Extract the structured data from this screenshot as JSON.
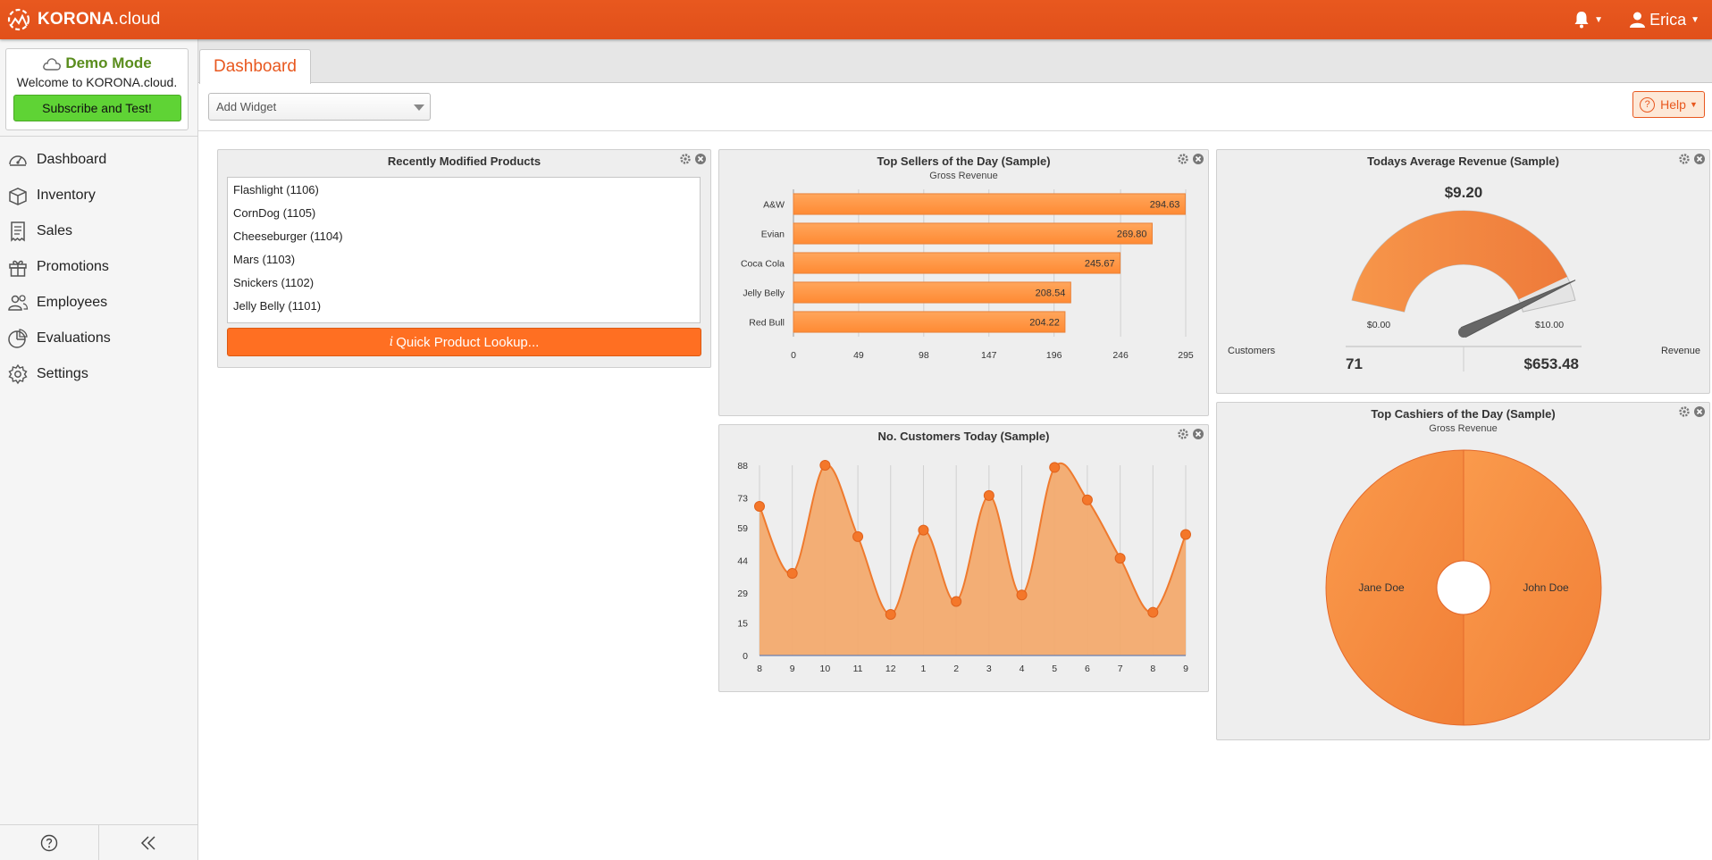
{
  "app": {
    "logo_bold": "KORONA",
    "logo_light": ".cloud",
    "user_name": "Erica"
  },
  "demo": {
    "title": "Demo Mode",
    "welcome": "Welcome to KORONA.cloud.",
    "subscribe_label": "Subscribe and Test!"
  },
  "nav": {
    "items": [
      {
        "label": "Dashboard",
        "icon": "dashboard-icon"
      },
      {
        "label": "Inventory",
        "icon": "inventory-icon"
      },
      {
        "label": "Sales",
        "icon": "sales-icon"
      },
      {
        "label": "Promotions",
        "icon": "promotions-icon"
      },
      {
        "label": "Employees",
        "icon": "employees-icon"
      },
      {
        "label": "Evaluations",
        "icon": "evaluations-icon"
      },
      {
        "label": "Settings",
        "icon": "settings-icon"
      }
    ]
  },
  "tabs": {
    "active": "Dashboard"
  },
  "toolbar": {
    "add_widget_placeholder": "Add Widget",
    "help_label": "Help"
  },
  "colors": {
    "brand": "#e8581f",
    "bar": "#ff9b4d",
    "demo_green": "#5a8d1d",
    "subscribe_green": "#5fd335"
  },
  "recent_products": {
    "title": "Recently Modified Products",
    "items": [
      "Flashlight (1106)",
      "CornDog (1105)",
      "Cheeseburger (1104)",
      "Mars (1103)",
      "Snickers (1102)",
      "Jelly Belly (1101)"
    ],
    "lookup_label": "Quick Product Lookup..."
  },
  "top_sellers": {
    "title": "Top Sellers of the Day (Sample)",
    "subtitle": "Gross Revenue"
  },
  "customers_today": {
    "title": "No. Customers Today (Sample)"
  },
  "avg_revenue": {
    "title": "Todays Average Revenue (Sample)",
    "value": "$9.20",
    "min_label": "$0.00",
    "max_label": "$10.00",
    "customers_label": "Customers",
    "customers_value": "71",
    "revenue_label": "Revenue",
    "revenue_value": "$653.48",
    "level": 0.92
  },
  "top_cashiers": {
    "title": "Top Cashiers of the Day (Sample)",
    "subtitle": "Gross Revenue"
  },
  "chart_data": [
    {
      "type": "bar",
      "title": "Top Sellers of the Day (Sample)",
      "subtitle": "Gross Revenue",
      "orientation": "horizontal",
      "categories": [
        "A&W",
        "Evian",
        "Coca Cola",
        "Jelly Belly",
        "Red Bull"
      ],
      "values": [
        294.63,
        269.8,
        245.67,
        208.54,
        204.22
      ],
      "data_labels": [
        "294.63",
        "269.80",
        "245.67",
        "208.54",
        "204.22"
      ],
      "ticks": [
        "0",
        "49",
        "98",
        "147",
        "196",
        "246",
        "295"
      ],
      "xlim": [
        0,
        295
      ],
      "grid": true
    },
    {
      "type": "area",
      "title": "No. Customers Today (Sample)",
      "x": [
        "8",
        "9",
        "10",
        "11",
        "12",
        "1",
        "2",
        "3",
        "4",
        "5",
        "6",
        "7",
        "8",
        "9"
      ],
      "values": [
        69,
        38,
        88,
        55,
        19,
        58,
        25,
        74,
        28,
        87,
        72,
        45,
        20,
        56
      ],
      "yticks": [
        "0",
        "15",
        "29",
        "44",
        "59",
        "73",
        "88"
      ],
      "ylim": [
        0,
        88
      ],
      "grid": true
    },
    {
      "type": "pie",
      "title": "Top Cashiers of the Day (Sample)",
      "subtitle": "Gross Revenue",
      "labels": [
        "John Doe",
        "Jane Doe"
      ],
      "values": [
        50,
        50
      ]
    }
  ]
}
